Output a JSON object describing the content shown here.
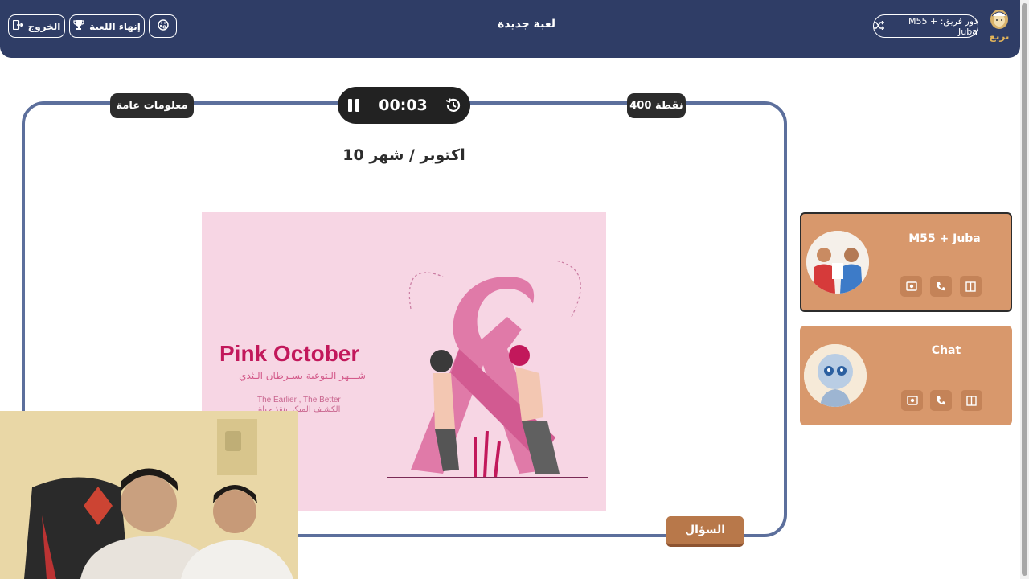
{
  "header": {
    "exit_label": "الخروج",
    "end_game_label": "إنهاء اللعبة",
    "title": "لعبة جديدة",
    "turn_label": "دور فريق: M55 + Juba",
    "logo_text": "تربع"
  },
  "board": {
    "category": "معلومات عامة",
    "points": "400 نقطة",
    "timer": "00:03",
    "question": "اكتوبر / شهر 10",
    "question_button": "السؤال"
  },
  "question_image": {
    "title": "Pink October",
    "subtitle_ar": "شـــهر الـتوعية بسـرطان الـثدي",
    "tagline_en": "The Earlier , The Better",
    "tagline_ar": "الكشـف المبكر ينقذ حياة"
  },
  "teams": [
    {
      "name": "M55 + Juba",
      "active": true
    },
    {
      "name": "Chat",
      "active": false
    }
  ],
  "colors": {
    "header_bg": "#2f3d66",
    "board_border": "#5c6f9c",
    "team_card": "#d8986c",
    "question_button": "#b8784a",
    "ribbon": "#e07aa8"
  },
  "icons": [
    "exit-icon",
    "trophy-icon",
    "palette-icon",
    "shuffle-icon",
    "pause-icon",
    "history-icon",
    "image-aid-icon",
    "phone-aid-icon",
    "split-aid-icon"
  ]
}
